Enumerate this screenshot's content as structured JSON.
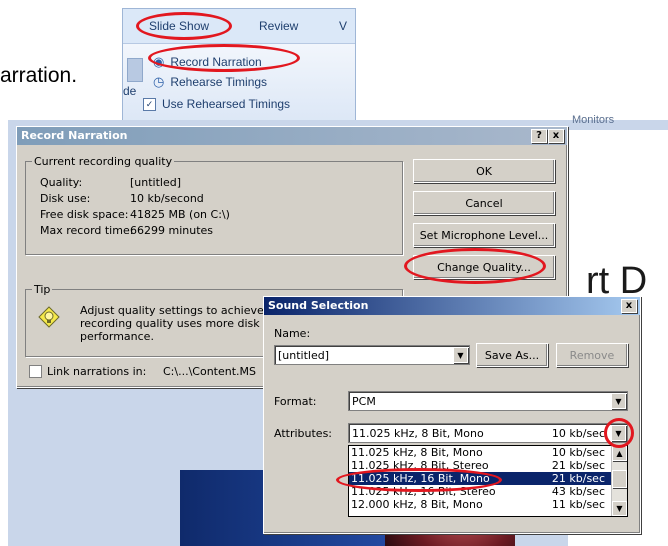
{
  "doc_text_fragment": "arration.",
  "ribbon": {
    "tabs": [
      "Slide Show",
      "Review",
      "V"
    ],
    "items": [
      "Record Narration",
      "Rehearse Timings",
      "Use Rehearsed Timings"
    ],
    "side_fragment": "de",
    "monitors_fragment": "Monitors"
  },
  "record_dialog": {
    "title": "Record Narration",
    "help_btn": "?",
    "close_btn": "x",
    "quality_group": "Current recording quality",
    "rows": [
      {
        "label": "Quality:",
        "value": "[untitled]"
      },
      {
        "label": "Disk use:",
        "value": "10 kb/second"
      },
      {
        "label": "Free disk space:",
        "value": "41825 MB (on C:\\)"
      },
      {
        "label": "Max record time:",
        "value": "66299 minutes"
      }
    ],
    "tip_group": "Tip",
    "tip_text_1": "Adjust quality settings to achieve",
    "tip_text_2": "recording quality uses more disk s",
    "tip_text_3": "performance.",
    "link_label": "Link narrations in:",
    "link_path": "C:\\...\\Content.MS",
    "buttons": {
      "ok": "OK",
      "cancel": "Cancel",
      "mic": "Set Microphone Level...",
      "quality": "Change Quality..."
    }
  },
  "sound_dialog": {
    "title": "Sound Selection",
    "close_btn": "x",
    "name_label": "Name:",
    "name_value": "[untitled]",
    "save_as": "Save As...",
    "remove": "Remove",
    "format_label": "Format:",
    "format_value": "PCM",
    "attributes_label": "Attributes:",
    "attributes_value": "11.025 kHz, 8 Bit, Mono",
    "attributes_rate": "10 kb/sec",
    "options": [
      {
        "label": "11.025 kHz, 8 Bit, Mono",
        "rate": "10 kb/sec"
      },
      {
        "label": "11.025 kHz, 8 Bit, Stereo",
        "rate": "21 kb/sec"
      },
      {
        "label": "11.025 kHz, 16 Bit, Mono",
        "rate": "21 kb/sec"
      },
      {
        "label": "11.025 kHz, 16 Bit, Stereo",
        "rate": "43 kb/sec"
      },
      {
        "label": "12.000 kHz, 8 Bit, Mono",
        "rate": "11 kb/sec"
      }
    ]
  },
  "slide_text_fragment": "rt D",
  "colors": {
    "highlight": "#e2171f",
    "selection": "#0a246a",
    "dialog_bg": "#d4d0c8"
  }
}
